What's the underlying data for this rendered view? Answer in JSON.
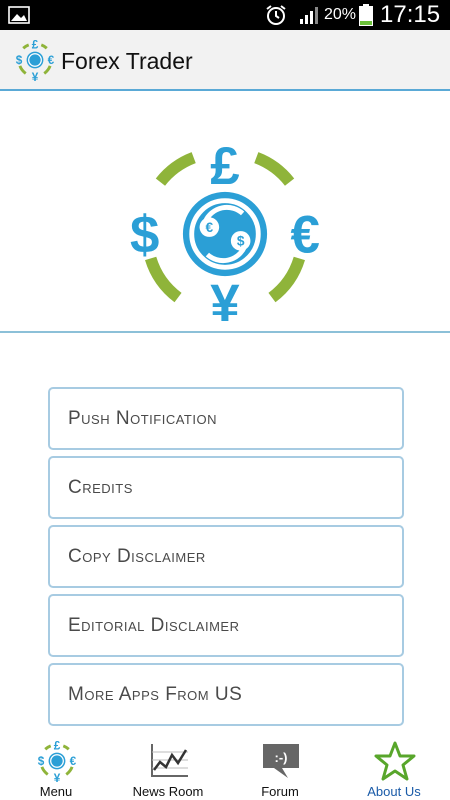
{
  "status_bar": {
    "battery_percent": "20%",
    "clock": "17:15"
  },
  "app_bar": {
    "title": "Forex Trader"
  },
  "menu": {
    "items": [
      {
        "label": "Push Notification"
      },
      {
        "label": "Credits"
      },
      {
        "label": "Copy Disclaimer"
      },
      {
        "label": "Editorial Disclaimer"
      },
      {
        "label": "More Apps From US"
      }
    ]
  },
  "tabs": [
    {
      "label": "Menu",
      "icon": "forex-logo-icon"
    },
    {
      "label": "News Room",
      "icon": "chart-icon"
    },
    {
      "label": "Forum",
      "icon": "chat-bubble-icon"
    },
    {
      "label": "About Us",
      "icon": "star-icon",
      "active": true
    }
  ],
  "colors": {
    "accent_blue": "#2b9fd6",
    "accent_green": "#8fb43a",
    "divider": "#5aa9d6",
    "button_border": "#a7cbe2",
    "active_tab": "#1a5ba8"
  }
}
